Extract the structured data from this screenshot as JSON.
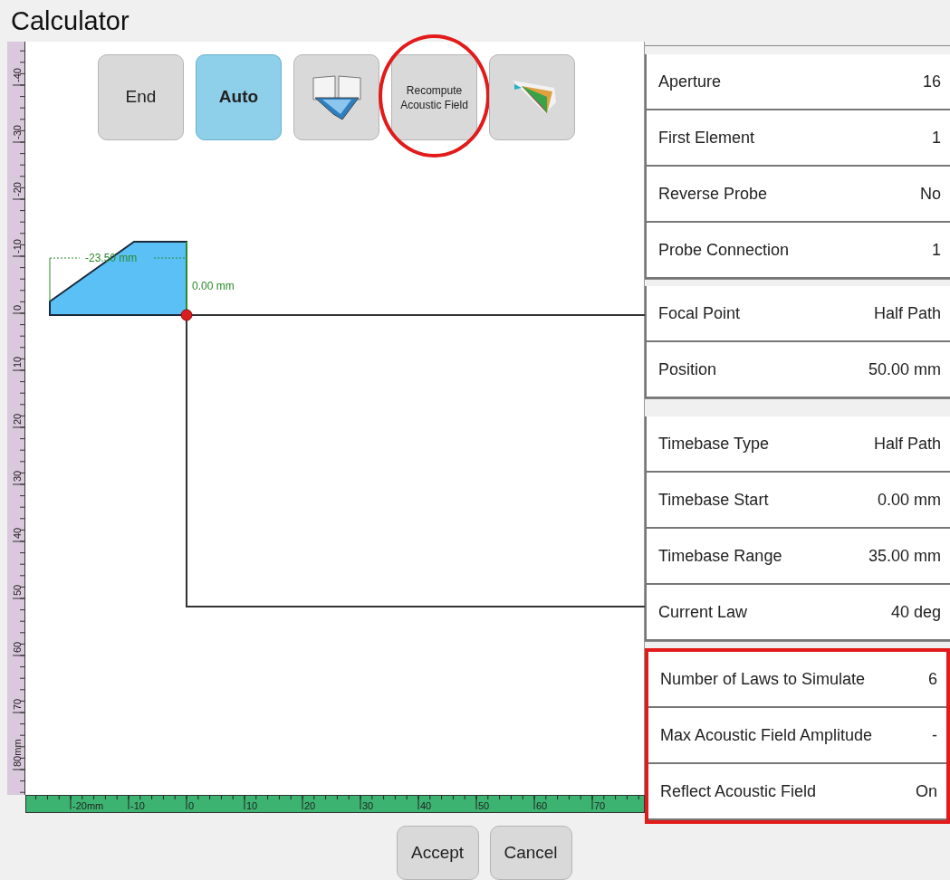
{
  "window": {
    "title": "Calculator"
  },
  "toolbar": [
    {
      "kind": "text",
      "label": "End",
      "active": false,
      "highlighted": false
    },
    {
      "kind": "text",
      "label": "Auto",
      "active": true,
      "highlighted": false
    },
    {
      "kind": "wedge",
      "active": false,
      "highlighted": false
    },
    {
      "kind": "small-text",
      "label": "Recompute Acoustic Field",
      "active": false,
      "highlighted": true
    },
    {
      "kind": "beam",
      "active": false,
      "highlighted": false
    }
  ],
  "rulers": {
    "vertical": [
      "-40",
      "-30",
      "-20",
      "-10",
      "0",
      "10",
      "20",
      "30",
      "40",
      "50",
      "60",
      "70",
      "80mm"
    ],
    "horizontal": [
      "-20mm",
      "-10",
      "0",
      "10",
      "20",
      "30",
      "40",
      "50",
      "60",
      "70"
    ]
  },
  "drawing": {
    "width_label": "-23.50 mm",
    "offset_label": "0.00 mm"
  },
  "groups": [
    {
      "highlighted": false,
      "rows": [
        {
          "label": "Aperture",
          "value": "16"
        },
        {
          "label": "First Element",
          "value": "1"
        },
        {
          "label": "Reverse Probe",
          "value": "No"
        },
        {
          "label": "Probe Connection",
          "value": "1"
        }
      ]
    },
    {
      "highlighted": false,
      "rows": [
        {
          "label": "Focal Point",
          "value": "Half Path"
        },
        {
          "label": "Position",
          "value": "50.00 mm"
        }
      ]
    },
    {
      "highlighted": false,
      "rows": [
        {
          "label": "Timebase Type",
          "value": "Half Path"
        },
        {
          "label": "Timebase Start",
          "value": "0.00 mm"
        },
        {
          "label": "Timebase Range",
          "value": "35.00 mm"
        },
        {
          "label": "Current Law",
          "value": "40 deg"
        }
      ]
    },
    {
      "highlighted": true,
      "rows": [
        {
          "label": "Number of Laws to Simulate",
          "value": "6"
        },
        {
          "label": "Max Acoustic Field Amplitude",
          "value": "-"
        },
        {
          "label": "Reflect Acoustic Field",
          "value": "On"
        }
      ]
    }
  ],
  "buttons": [
    "Accept",
    "Cancel"
  ]
}
